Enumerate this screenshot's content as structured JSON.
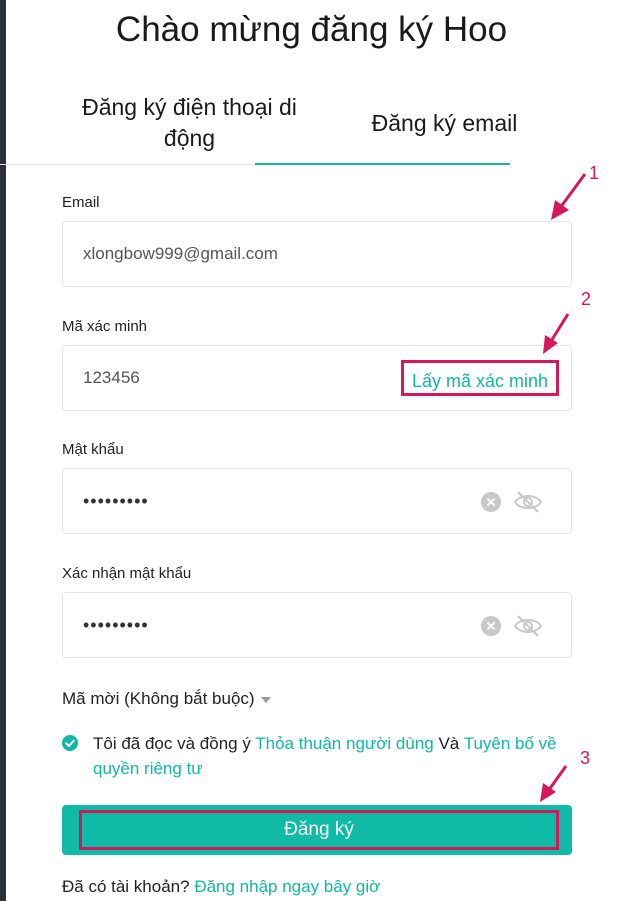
{
  "page": {
    "title": "Chào mừng đăng ký Hoo"
  },
  "tabs": [
    {
      "label": "Đăng ký điện thoại di động",
      "active": false
    },
    {
      "label": "Đăng ký email",
      "active": true
    }
  ],
  "fields": {
    "email": {
      "label": "Email",
      "value": "xlongbow999@gmail.com"
    },
    "code": {
      "label": "Mã xác minh",
      "value": "123456",
      "action_label": "Lấy mã xác minh"
    },
    "password": {
      "label": "Mật khẩu",
      "value": "•••••••••"
    },
    "confirm": {
      "label": "Xác nhận mật khẩu",
      "value": "•••••••••"
    }
  },
  "invite": {
    "label": "Mã mời (Không bắt buộc)"
  },
  "agreement": {
    "prefix": "Tôi đã đọc và đồng ý ",
    "terms_link": "Thỏa thuận người dùng",
    "conj": " Và ",
    "privacy_link": "Tuyên bố về quyền riêng tư",
    "checked": true
  },
  "submit": {
    "label": "Đăng ký"
  },
  "login": {
    "prefix": "Đã có tài khoản? ",
    "link": "Đăng nhập ngay bây giờ"
  },
  "annotations": {
    "one": "1",
    "two": "2",
    "three": "3"
  },
  "colors": {
    "accent": "#10b7a4",
    "annotation": "#d4185a"
  }
}
